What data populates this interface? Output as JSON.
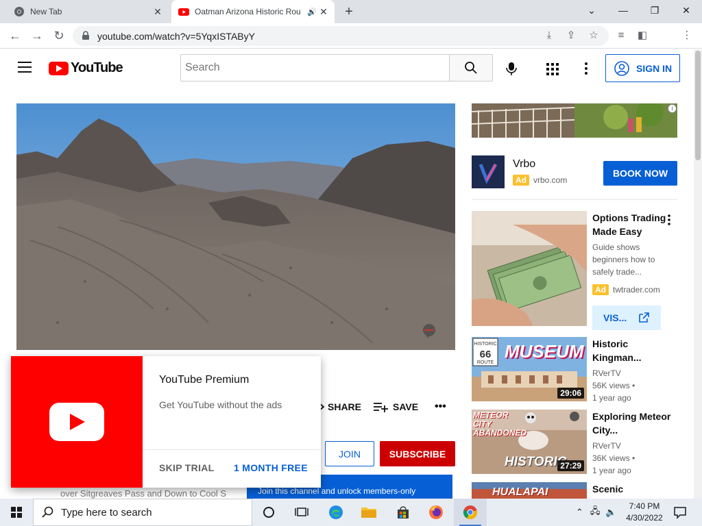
{
  "browser": {
    "tabs": [
      {
        "title": "New Tab",
        "active": false
      },
      {
        "title": "Oatman Arizona Historic Rou",
        "active": true,
        "audio": true
      }
    ],
    "url": "youtube.com/watch?v=5YqxISTAByY"
  },
  "header": {
    "logo_text": "YouTube",
    "search_placeholder": "Search",
    "sign_in_label": "SIGN IN"
  },
  "actions": {
    "share_label": "SHARE",
    "save_label": "SAVE",
    "join_label": "JOIN",
    "subscribe_label": "SUBSCRIBE",
    "member_banner": "Join this channel and unlock members-only",
    "description_peek": "Oatman Arizona Historic Route 66 - Gold ... 66 over Sitgreaves Pass and Down to Cool S"
  },
  "premium_promo": {
    "title": "YouTube Premium",
    "subtitle": "Get YouTube without the ads",
    "skip_label": "SKIP TRIAL",
    "accept_label": "1 MONTH FREE"
  },
  "sidebar": {
    "ad1": {
      "advertiser": "Vrbo",
      "ad_badge": "Ad",
      "domain": "vrbo.com",
      "cta": "BOOK NOW"
    },
    "ad2": {
      "title": "Options Trading Made Easy",
      "description": "Guide shows beginners how to safely trade...",
      "ad_badge": "Ad",
      "domain": "twtrader.com",
      "cta": "VIS..."
    },
    "recommendations": [
      {
        "title": "Historic Kingman...",
        "channel": "RVerTV",
        "views": "56K views",
        "age": "1 year ago",
        "duration": "29:06",
        "thumb_text": "MUSEUM"
      },
      {
        "title": "Exploring Meteor City...",
        "channel": "RVerTV",
        "views": "36K views",
        "age": "1 year ago",
        "duration": "27:29",
        "thumb_text": "METEOR CITY ABANDONED"
      },
      {
        "title": "Scenic",
        "channel": "",
        "views": "",
        "age": "",
        "duration": "",
        "thumb_text": "HUALAPAI"
      }
    ]
  },
  "taskbar": {
    "search_placeholder": "Type here to search",
    "time": "7:40 PM",
    "date": "4/30/2022"
  }
}
